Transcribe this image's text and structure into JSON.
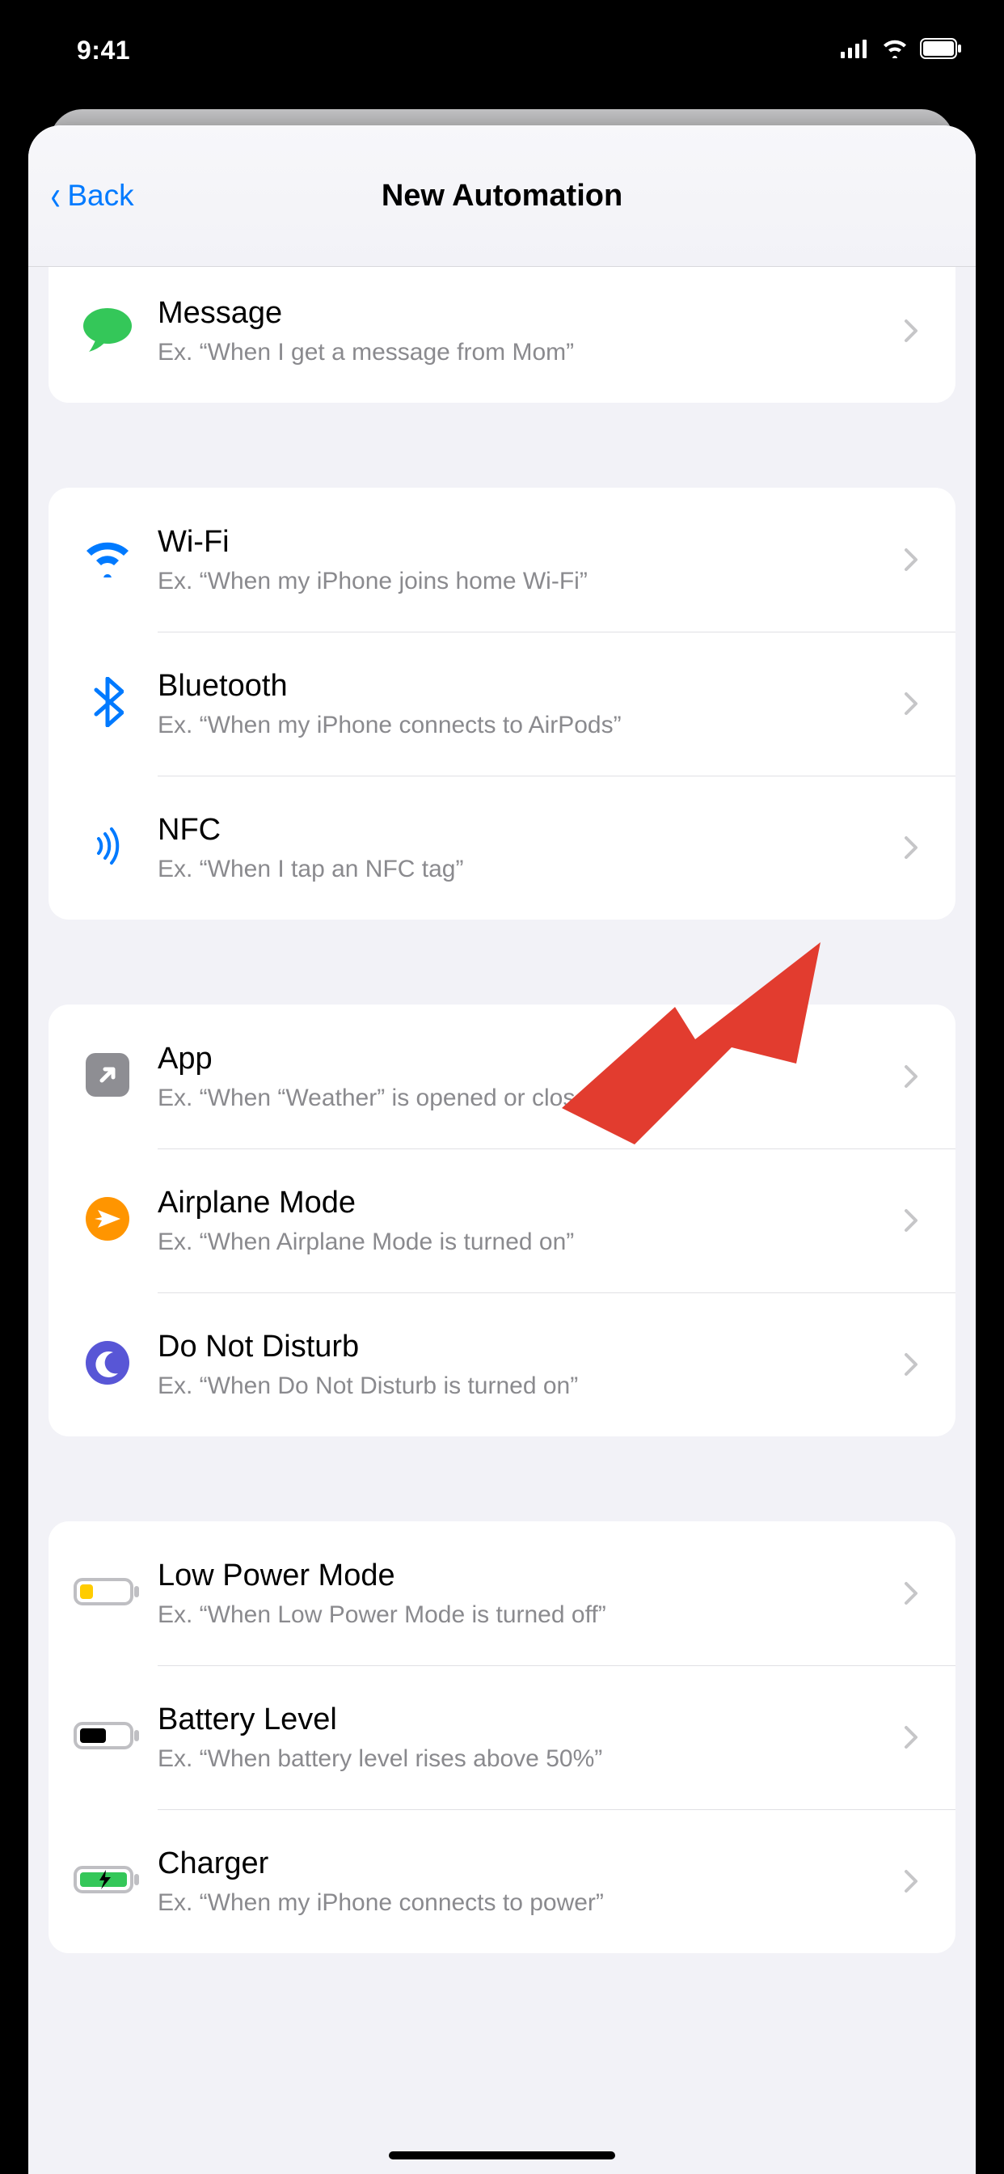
{
  "status": {
    "time": "9:41"
  },
  "nav": {
    "back": "Back",
    "title": "New Automation"
  },
  "groups": [
    {
      "rows": [
        {
          "id": "message",
          "icon": "message-icon",
          "title": "Message",
          "subtitle": "Ex. “When I get a message from Mom”"
        }
      ]
    },
    {
      "rows": [
        {
          "id": "wifi",
          "icon": "wifi-icon",
          "title": "Wi-Fi",
          "subtitle": "Ex. “When my iPhone joins home Wi-Fi”"
        },
        {
          "id": "bluetooth",
          "icon": "bluetooth-icon",
          "title": "Bluetooth",
          "subtitle": "Ex. “When my iPhone connects to AirPods”"
        },
        {
          "id": "nfc",
          "icon": "nfc-icon",
          "title": "NFC",
          "subtitle": "Ex. “When I tap an NFC tag”"
        }
      ]
    },
    {
      "rows": [
        {
          "id": "app",
          "icon": "app-icon",
          "title": "App",
          "subtitle": "Ex. “When “Weather” is opened or closed”"
        },
        {
          "id": "airplane",
          "icon": "airplane-icon",
          "title": "Airplane Mode",
          "subtitle": "Ex. “When Airplane Mode is turned on”"
        },
        {
          "id": "dnd",
          "icon": "dnd-icon",
          "title": "Do Not Disturb",
          "subtitle": "Ex. “When Do Not Disturb is turned on”"
        }
      ]
    },
    {
      "rows": [
        {
          "id": "lowpower",
          "icon": "lowpower-icon",
          "title": "Low Power Mode",
          "subtitle": "Ex. “When Low Power Mode is turned off”"
        },
        {
          "id": "battery",
          "icon": "battery-icon",
          "title": "Battery Level",
          "subtitle": "Ex. “When battery level rises above 50%”"
        },
        {
          "id": "charger",
          "icon": "charger-icon",
          "title": "Charger",
          "subtitle": "Ex. “When my iPhone connects to power”"
        }
      ]
    }
  ],
  "annotation": {
    "points_to": "app",
    "color": "#e23c2f"
  }
}
